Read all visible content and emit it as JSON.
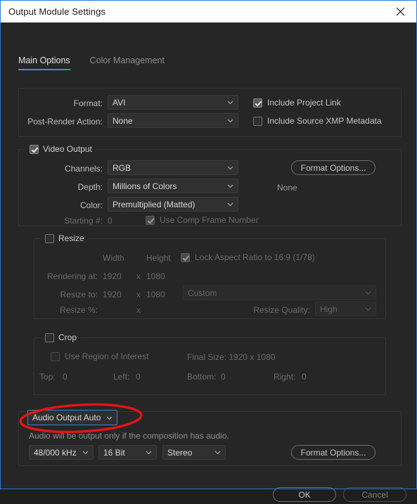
{
  "window": {
    "title": "Output Module Settings",
    "close_icon": "close-icon",
    "accent": "#2b7cd3",
    "titlebar_bg": "#ffffff",
    "body_bg": "#262626"
  },
  "tabs": [
    {
      "label": "Main Options",
      "active": true
    },
    {
      "label": "Color Management",
      "active": false
    }
  ],
  "format_panel": {
    "format_label": "Format:",
    "format_value": "AVI",
    "post_render_label": "Post-Render Action:",
    "post_render_value": "None",
    "include_project_link_label": "Include Project Link",
    "include_project_link_checked": true,
    "include_xmp_label": "Include Source XMP Metadata",
    "include_xmp_checked": false
  },
  "video_output": {
    "legend": "Video Output",
    "legend_checked": true,
    "channels_label": "Channels:",
    "channels_value": "RGB",
    "depth_label": "Depth:",
    "depth_value": "Millions of Colors",
    "color_label": "Color:",
    "color_value": "Premultiplied (Matted)",
    "starting_label": "Starting #:",
    "starting_value": "0",
    "use_comp_frame_label": "Use Comp Frame Number",
    "use_comp_frame_checked": true,
    "format_options_button": "Format Options...",
    "format_options_status": "None"
  },
  "resize": {
    "legend": "Resize",
    "legend_checked": false,
    "width_header": "Width",
    "height_header": "Height",
    "lock_aspect_label": "Lock Aspect Ratio to 16:9 (1/78)",
    "lock_aspect_checked": true,
    "rendering_at_label": "Rendering at:",
    "rendering_width": "1920",
    "rendering_x": "x",
    "rendering_height": "1080",
    "resize_to_label": "Resize to:",
    "resize_width": "1920",
    "resize_x": "x",
    "resize_height": "1080",
    "preset_value": "Custom",
    "resize_pct_label": "Resize %:",
    "resize_pct_x": "x",
    "resize_quality_label": "Resize Quality:",
    "resize_quality_value": "High"
  },
  "crop": {
    "legend": "Crop",
    "legend_checked": false,
    "region_of_interest_label": "Use Region of Interest",
    "region_of_interest_checked": false,
    "final_size_label": "Final Size: 1920 x 1080",
    "top_label": "Top:",
    "top_value": "0",
    "left_label": "Left:",
    "left_value": "0",
    "bottom_label": "Bottom:",
    "bottom_value": "0",
    "right_label": "Right:",
    "right_value": "0"
  },
  "audio_output": {
    "legend_value": "Audio Output Auto",
    "note": "Audio will be output only if the composition has audio.",
    "sample_rate_value": "48/000 kHz",
    "bit_depth_value": "16 Bit",
    "channels_value": "Stereo",
    "format_options_button": "Format Options..."
  },
  "annotation": {
    "type": "red-ellipse-highlight",
    "color": "#e81313",
    "target": "audio-output-mode-select"
  },
  "footer": {
    "ok_label": "OK",
    "cancel_label": "Cancel"
  }
}
